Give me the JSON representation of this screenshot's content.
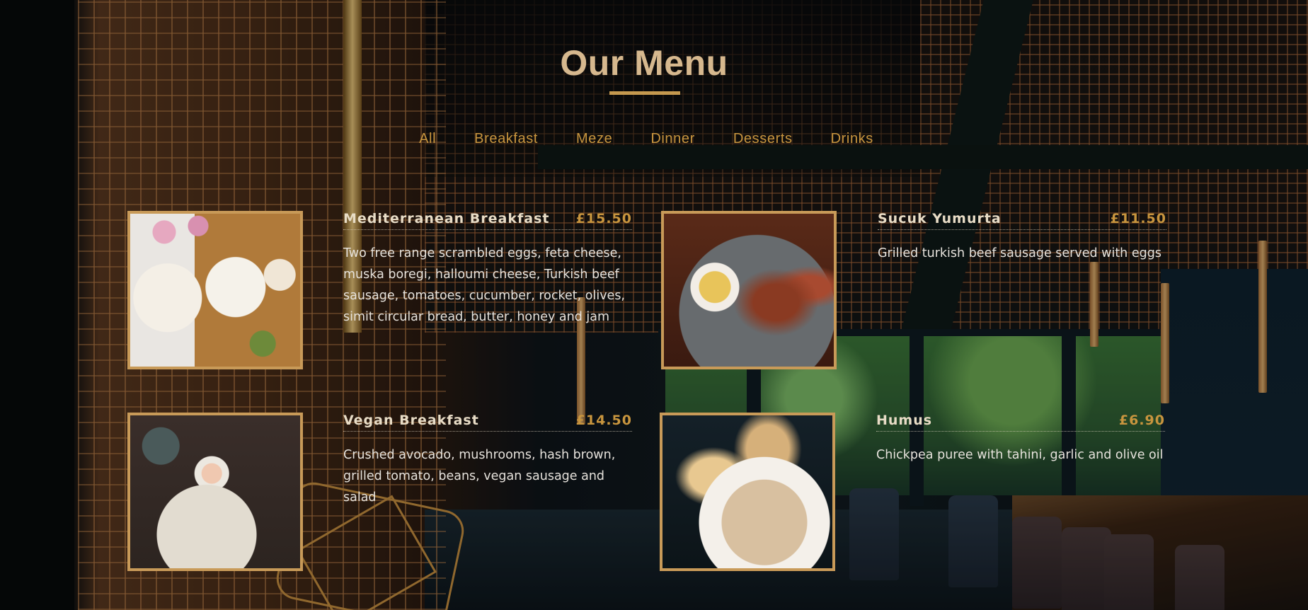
{
  "header": {
    "title": "Our Menu"
  },
  "filters": [
    {
      "label": "All"
    },
    {
      "label": "Breakfast"
    },
    {
      "label": "Meze"
    },
    {
      "label": "Dinner"
    },
    {
      "label": "Desserts"
    },
    {
      "label": "Drinks"
    }
  ],
  "menu_items": [
    {
      "name": "Mediterranean Breakfast",
      "price": "£15.50",
      "description": "Two free range scrambled eggs, feta cheese, muska boregi, halloumi cheese, Turkish beef sausage, tomatoes, cucumber, rocket, olives, simit circular bread, butter, honey and jam"
    },
    {
      "name": "Sucuk Yumurta",
      "price": "£11.50",
      "description": "Grilled turkish beef sausage served with eggs"
    },
    {
      "name": "Vegan Breakfast",
      "price": "£14.50",
      "description": "Crushed avocado, mushrooms, hash brown, grilled tomato, beans, vegan sausage and salad"
    },
    {
      "name": "Humus",
      "price": "£6.90",
      "description": "Chickpea puree with tahini, garlic and olive oil"
    }
  ],
  "colors": {
    "accent": "#c8953e",
    "title": "#d6b88e",
    "frame": "#c89a58"
  }
}
